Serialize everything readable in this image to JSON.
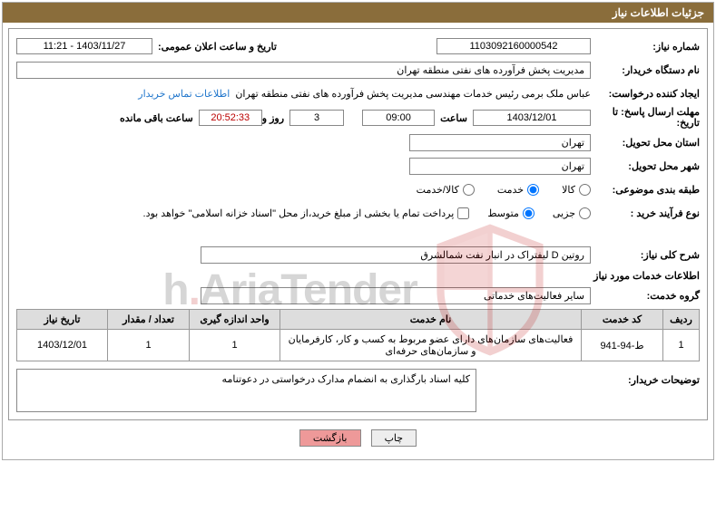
{
  "header": {
    "title": "جزئیات اطلاعات نیاز"
  },
  "req": {
    "number_label": "شماره نیاز:",
    "number": "1103092160000542",
    "announce_label": "تاریخ و ساعت اعلان عمومی:",
    "announce": "1403/11/27 - 11:21",
    "buyer_label": "نام دستگاه خریدار:",
    "buyer": "مدیریت پخش فرآورده های نفتی منطقه تهران",
    "creator_label": "ایجاد کننده درخواست:",
    "creator": "عباس ملک برمی رئیس خدمات مهندسی مدیریت پخش فرآورده های نفتی منطقه تهران",
    "contact_link": "اطلاعات تماس خریدار",
    "deadline_label_line1": "مهلت ارسال پاسخ: تا",
    "deadline_label_line2": "تاریخ:",
    "deadline_date": "1403/12/01",
    "deadline_time_label": "ساعت",
    "deadline_time": "09:00",
    "remain_days": "3",
    "remain_and": "روز و",
    "remain_time": "20:52:33",
    "remain_suffix": "ساعت باقی مانده",
    "province_label": "استان محل تحویل:",
    "province": "تهران",
    "city_label": "شهر محل تحویل:",
    "city": "تهران"
  },
  "cat": {
    "label": "طبقه بندی موضوعی:",
    "opt1": "کالا",
    "opt2": "خدمت",
    "opt3": "کالا/خدمت"
  },
  "ptype": {
    "label": "نوع فرآیند خرید :",
    "opt1": "جزیی",
    "opt2": "متوسط",
    "chk_label": "پرداخت تمام یا بخشی از مبلغ خرید،از محل \"اسناد خزانه اسلامی\" خواهد بود."
  },
  "need": {
    "summary_label": "شرح کلی نیاز:",
    "summary": "روتین D لیفتراک در انبار نفت شمالشرق",
    "services_header": "اطلاعات خدمات مورد نیاز",
    "group_label": "گروه خدمت:",
    "group": "سایر فعالیت‌های خدماتی"
  },
  "table": {
    "h_row": "ردیف",
    "h_code": "کد خدمت",
    "h_name": "نام خدمت",
    "h_unit": "واحد اندازه گیری",
    "h_qty": "تعداد / مقدار",
    "h_date": "تاریخ نیاز",
    "rows": [
      {
        "n": "1",
        "code": "ط-94-941",
        "name": "فعالیت‌های سازمان‌های دارای عضو مربوط به کسب و کار، کارفرمایان و سازمان‌های حرفه‌ای",
        "unit": "1",
        "qty": "1",
        "date": "1403/12/01"
      }
    ]
  },
  "desc": {
    "label": "توضیحات خریدار:",
    "text": "کلیه اسناد بارگذاری به انضمام مدارک درخواستی در دعوتنامه"
  },
  "buttons": {
    "print": "چاپ",
    "back": "بازگشت"
  },
  "watermark": {
    "text_a": "AriaTender",
    "dot": ".",
    "text_b": "h"
  }
}
